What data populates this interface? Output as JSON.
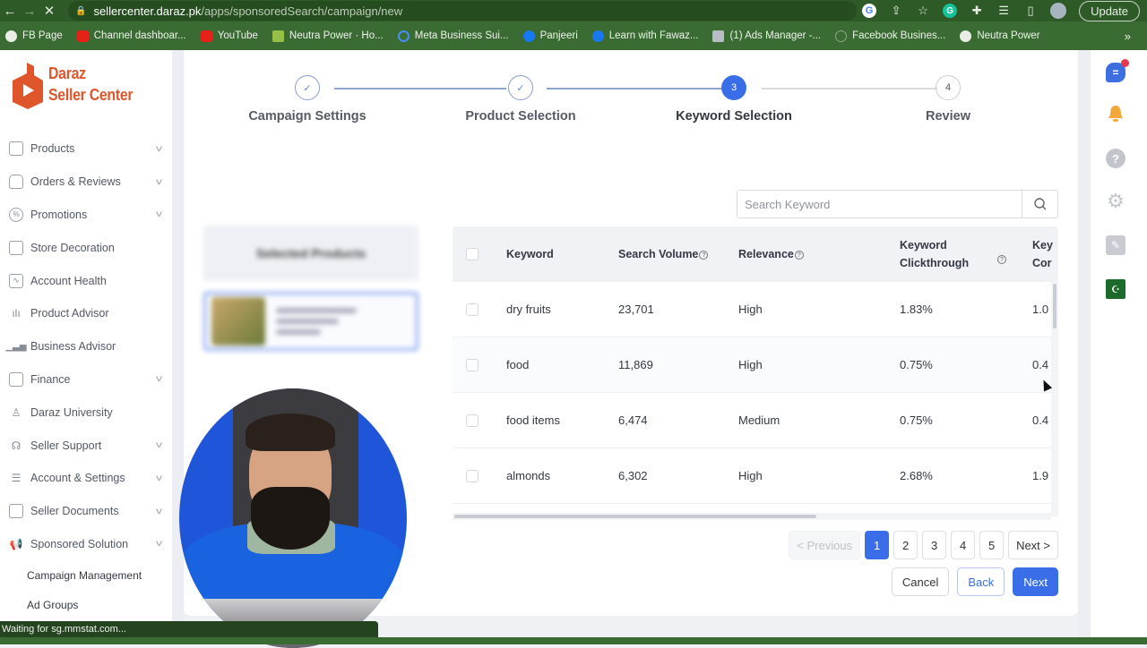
{
  "browser": {
    "url_host": "sellercenter.daraz.pk",
    "url_path": "/apps/sponsoredSearch/campaign/new",
    "update_label": "Update",
    "toolbar_icons": [
      "google-icon",
      "share-icon",
      "star-icon",
      "grammarly-icon",
      "extensions-icon",
      "reading-list-icon",
      "side-panel-icon",
      "profile-avatar"
    ],
    "bookmarks": [
      {
        "label": "FB Page",
        "icon": "globe-icon"
      },
      {
        "label": "Channel dashboar...",
        "icon": "youtube-icon"
      },
      {
        "label": "YouTube",
        "icon": "youtube-icon"
      },
      {
        "label": "Neutra Power · Ho...",
        "icon": "shopify-icon"
      },
      {
        "label": "Meta Business Sui...",
        "icon": "meta-icon"
      },
      {
        "label": "Panjeeri",
        "icon": "facebook-icon"
      },
      {
        "label": "Learn with Fawaz...",
        "icon": "facebook-icon"
      },
      {
        "label": "(1) Ads Manager -...",
        "icon": "ads-manager-icon"
      },
      {
        "label": "Facebook Busines...",
        "icon": "facebook-business-icon"
      },
      {
        "label": "Neutra Power",
        "icon": "globe-icon"
      }
    ],
    "more_bookmarks": "»",
    "status_text": "Waiting for sg.mmstat.com..."
  },
  "brand": {
    "line1": "Daraz",
    "line2": "Seller Center",
    "color": "#e0562c"
  },
  "sidebar": {
    "items": [
      {
        "label": "Products",
        "icon": "box-icon",
        "expandable": true
      },
      {
        "label": "Orders & Reviews",
        "icon": "bag-icon",
        "expandable": true
      },
      {
        "label": "Promotions",
        "icon": "discount-icon",
        "expandable": true
      },
      {
        "label": "Store Decoration",
        "icon": "store-icon",
        "expandable": false
      },
      {
        "label": "Account Health",
        "icon": "pulse-icon",
        "expandable": false
      },
      {
        "label": "Product Advisor",
        "icon": "bar-chart-icon",
        "expandable": false
      },
      {
        "label": "Business Advisor",
        "icon": "growth-chart-icon",
        "expandable": false
      },
      {
        "label": "Finance",
        "icon": "wallet-icon",
        "expandable": true
      },
      {
        "label": "Daraz University",
        "icon": "graduate-icon",
        "expandable": false
      },
      {
        "label": "Seller Support",
        "icon": "headset-icon",
        "expandable": true
      },
      {
        "label": "Account & Settings",
        "icon": "sliders-icon",
        "expandable": true
      },
      {
        "label": "Seller Documents",
        "icon": "document-icon",
        "expandable": true
      },
      {
        "label": "Sponsored Solution",
        "icon": "megaphone-icon",
        "expandable": true
      }
    ],
    "subitems": [
      "Campaign Management",
      "Ad Groups"
    ]
  },
  "stepper": {
    "steps": [
      {
        "label": "Campaign Settings",
        "state": "done",
        "marker": "✓"
      },
      {
        "label": "Product Selection",
        "state": "done",
        "marker": "✓"
      },
      {
        "label": "Keyword Selection",
        "state": "active",
        "marker": "3"
      },
      {
        "label": "Review",
        "state": "todo",
        "marker": "4"
      }
    ]
  },
  "selected_products": {
    "title": "Selected Products",
    "blurred": true
  },
  "search": {
    "placeholder": "Search Keyword",
    "value": ""
  },
  "table": {
    "columns": [
      {
        "label": "Keyword",
        "help": false
      },
      {
        "label": "Search Volume",
        "help": true
      },
      {
        "label": "Relevance",
        "help": true
      },
      {
        "label": "Keyword Clickthrough",
        "help": true
      },
      {
        "label": "Key Cor",
        "help": false
      }
    ],
    "rows": [
      {
        "keyword": "dry fruits",
        "volume": "23,701",
        "relevance": "High",
        "ctr": "1.83%",
        "conv": "1.0"
      },
      {
        "keyword": "food",
        "volume": "11,869",
        "relevance": "High",
        "ctr": "0.75%",
        "conv": "0.4"
      },
      {
        "keyword": "food items",
        "volume": "6,474",
        "relevance": "Medium",
        "ctr": "0.75%",
        "conv": "0.4"
      },
      {
        "keyword": "almonds",
        "volume": "6,302",
        "relevance": "High",
        "ctr": "2.68%",
        "conv": "1.9"
      }
    ]
  },
  "pagination": {
    "previous": "< Previous",
    "pages": [
      "1",
      "2",
      "3",
      "4",
      "5"
    ],
    "current": "1",
    "next": "Next >"
  },
  "actions": {
    "cancel": "Cancel",
    "back": "Back",
    "next": "Next"
  },
  "colors": {
    "primary": "#3a6ee8",
    "browser_green": "#2e5a27"
  },
  "right_rail": [
    "chat-icon",
    "bell-icon",
    "help-icon",
    "gear-icon",
    "edit-icon",
    "pakistan-flag-icon"
  ]
}
